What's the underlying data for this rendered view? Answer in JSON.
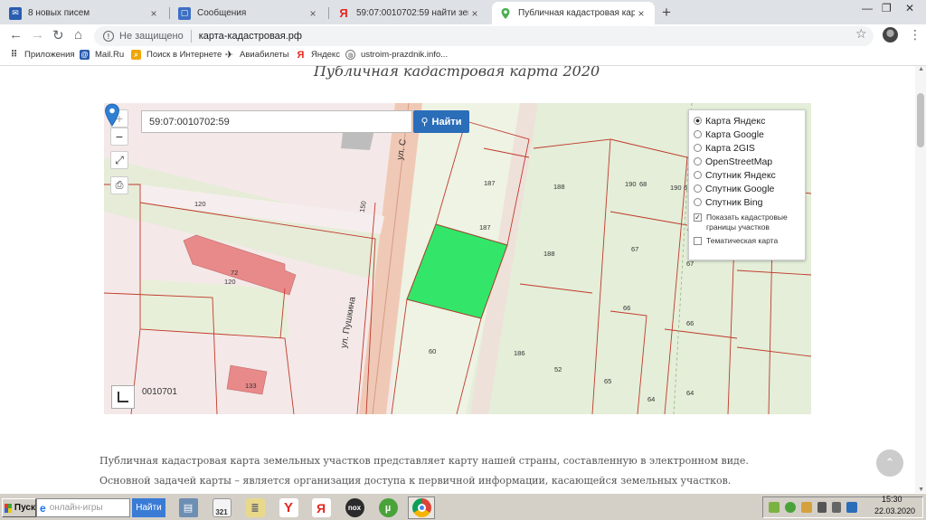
{
  "tabs": [
    {
      "label": "8 новых писем",
      "icon": "mail-icon",
      "color": "#2a5db0"
    },
    {
      "label": "Сообщения",
      "icon": "messages-icon",
      "color": "#3d6fc4"
    },
    {
      "label": "59:07:0010702:59 найти земельны",
      "icon": "yandex-icon",
      "color": "#e52620"
    },
    {
      "label": "Публичная кадастровая карта рос",
      "icon": "map-pin-icon",
      "color": "#4caf50"
    }
  ],
  "address_bar": {
    "insecure_label": "Не защищено",
    "url": "карта-кадастровая.рф"
  },
  "bookmarks": [
    {
      "label": "Приложения",
      "icon": "apps-icon",
      "color": "#777"
    },
    {
      "label": "Mail.Ru",
      "icon": "mailru-icon",
      "color": "#2a5db0"
    },
    {
      "label": "Поиск в Интернете",
      "icon": "search-icon",
      "color": "#f0a500"
    },
    {
      "label": "Авиабилеты",
      "icon": "plane-icon",
      "color": "#333"
    },
    {
      "label": "Яндекс",
      "icon": "yandex-icon",
      "color": "#e52620"
    },
    {
      "label": "ustroim-prazdnik.info...",
      "icon": "globe-icon",
      "color": "#555"
    }
  ],
  "page": {
    "title": "Публичная кадастровая карта 2020",
    "paragraphs": [
      "Публичная кадастровая карта земельных участков представляет карту нашей страны, составленную в электронном виде.",
      "Основной задачей карты – является организация доступа к первичной информации, касающейся земельных участков."
    ]
  },
  "map": {
    "search_value": "59:07:0010702:59",
    "search_button": "Найти",
    "zoom_in": "+",
    "zoom_out": "−",
    "block_code": "0010701",
    "street_1": "ул. Пушкина",
    "street_2": "ул. С",
    "parcel_labels": [
      "187",
      "187",
      "188",
      "188",
      "190",
      "68",
      "190",
      "6",
      "67",
      "67",
      "66",
      "66",
      "186",
      "52",
      "65",
      "64",
      "64",
      "60",
      "120",
      "72",
      "120",
      "150",
      "133"
    ],
    "layers": [
      {
        "label": "Карта Яндекс",
        "selected": true
      },
      {
        "label": "Карта Google",
        "selected": false
      },
      {
        "label": "Карта 2GIS",
        "selected": false
      },
      {
        "label": "OpenStreetMap",
        "selected": false
      },
      {
        "label": "Спутник Яндекс",
        "selected": false
      },
      {
        "label": "Спутник Google",
        "selected": false
      },
      {
        "label": "Спутник Bing",
        "selected": false
      }
    ],
    "options": [
      {
        "label": "Показать кадастровые границы участков",
        "checked": true
      },
      {
        "label": "Тематическая карта",
        "checked": false
      }
    ],
    "colors": {
      "highlight_parcel": "#33e66a",
      "buildings": "#e8898a",
      "road": "#e9b9a6",
      "boundary": "#c0392b"
    }
  },
  "taskbar": {
    "start_label": "Пуск",
    "search_placeholder": "онлайн-игры",
    "search_button": "Найти",
    "apps": [
      "file-manager-icon",
      "calendar-icon",
      "notepad-icon",
      "yandex-browser-icon",
      "yandex-icon",
      "nox-icon",
      "utorrent-icon",
      "chrome-icon"
    ],
    "calendar_number": "321",
    "nox_label": "nox",
    "time": "15:30",
    "date": "22.03.2020"
  }
}
